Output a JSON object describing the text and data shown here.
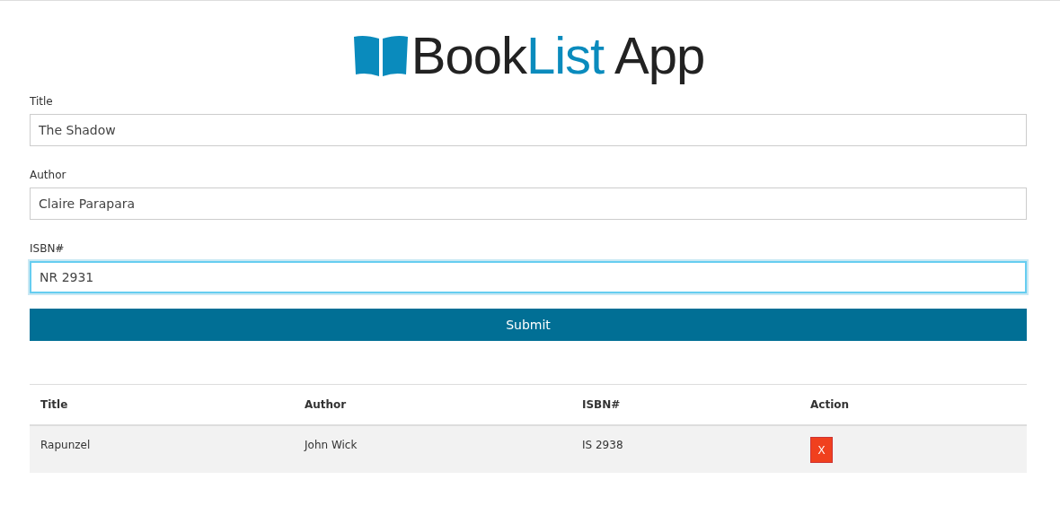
{
  "logo": {
    "parts": [
      {
        "text": "Book",
        "highlight": false
      },
      {
        "text": "List",
        "highlight": true
      },
      {
        "text": " App",
        "highlight": false
      }
    ]
  },
  "form": {
    "fields": [
      {
        "label": "Title",
        "value": "The Shadow",
        "focused": false
      },
      {
        "label": "Author",
        "value": "Claire Parapara",
        "focused": false
      },
      {
        "label": "ISBN#",
        "value": "NR 2931",
        "focused": true
      }
    ],
    "submit": "Submit"
  },
  "table": {
    "columns": [
      "Title",
      "Author",
      "ISBN#",
      "Action"
    ],
    "rows": [
      {
        "title": "Rapunzel",
        "author": "John Wick",
        "isbn": "IS 2938",
        "delete": "X"
      }
    ]
  }
}
